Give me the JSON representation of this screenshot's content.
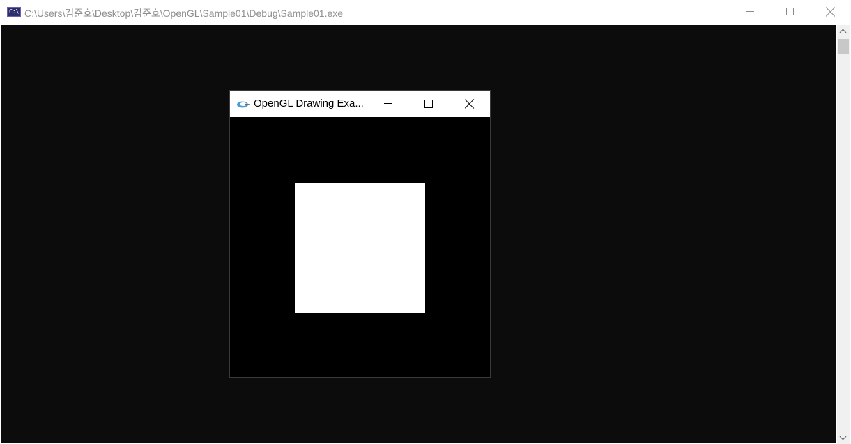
{
  "console": {
    "title": "C:\\Users\\김준호\\Desktop\\김준호\\OpenGL\\Sample01\\Debug\\Sample01.exe",
    "icon_text": "C:\\",
    "icon": "console-app-icon",
    "caption_buttons": [
      "minimize-icon",
      "maximize-icon",
      "close-icon"
    ],
    "background_color": "#0c0c0c"
  },
  "gl_window": {
    "title": "OpenGL Drawing Exa...",
    "icon": "opengl-app-icon",
    "caption_buttons": [
      "minimize-icon",
      "maximize-icon",
      "close-icon"
    ],
    "clear_color": "#000000",
    "shape": {
      "type": "square",
      "color": "#ffffff"
    }
  }
}
